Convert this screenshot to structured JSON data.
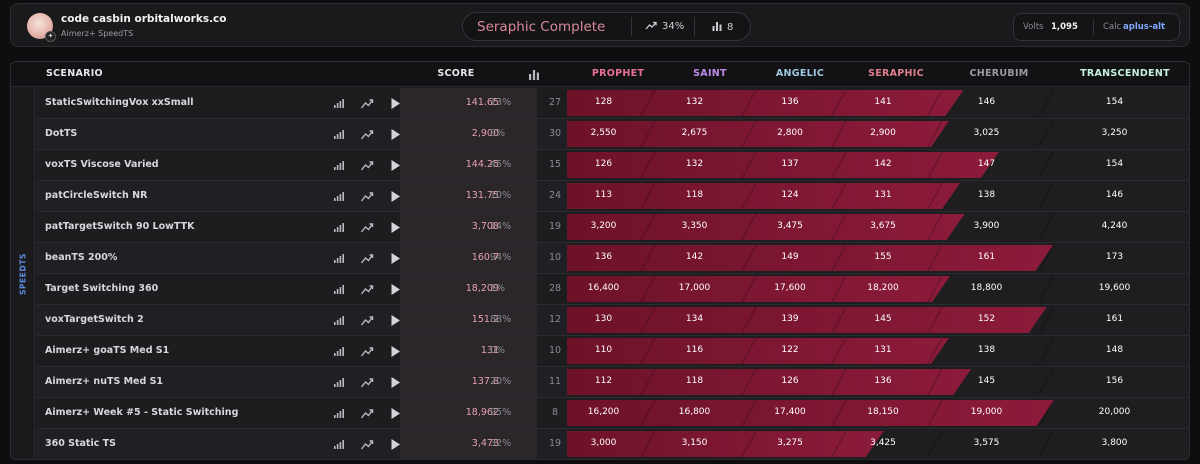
{
  "header": {
    "user": {
      "name": "code casbin orbitalworks.co",
      "subtitle": "Aimerz+ SpeedTS",
      "badge_glyph": "✦"
    },
    "rank": {
      "name": "Seraphic Complete",
      "progress": "34%",
      "count": "8"
    },
    "meta": {
      "volts_label": "Volts",
      "volts_value": "1,095",
      "calc_label": "Calc",
      "calc_value": "aplus-alt"
    }
  },
  "table": {
    "headers": {
      "scenario": "SCENARIO",
      "score": "SCORE",
      "plays_icon": "bar-chart-icon"
    },
    "tiers": [
      {
        "name": "PROPHET",
        "color": "#e86f9a"
      },
      {
        "name": "SAINT",
        "color": "#c08ae8"
      },
      {
        "name": "ANGELIC",
        "color": "#9ec8e0"
      },
      {
        "name": "SERAPHIC",
        "color": "#e07f8f"
      },
      {
        "name": "CHERUBIM",
        "color": "#9a9aa0"
      },
      {
        "name": "TRANSCENDENT",
        "color": "#c6f0e0"
      }
    ],
    "group_label": "SPEEDTS",
    "rows": [
      {
        "name": "StaticSwitchingVox xxSmall",
        "score": "141.65",
        "pct": "13%",
        "plays": "27",
        "progress": 0.13,
        "reached": 4,
        "thresholds": [
          "128",
          "132",
          "136",
          "141",
          "146",
          "154"
        ]
      },
      {
        "name": "DotTS",
        "score": "2,900",
        "pct": "0%",
        "plays": "30",
        "progress": 0.0,
        "reached": 4,
        "thresholds": [
          "2,550",
          "2,675",
          "2,800",
          "2,900",
          "3,025",
          "3,250"
        ]
      },
      {
        "name": "voxTS Viscose Varied",
        "score": "144.25",
        "pct": "45%",
        "plays": "15",
        "progress": 0.45,
        "reached": 4,
        "thresholds": [
          "126",
          "132",
          "137",
          "142",
          "147",
          "154"
        ]
      },
      {
        "name": "patCircleSwitch NR",
        "score": "131.75",
        "pct": "10%",
        "plays": "24",
        "progress": 0.1,
        "reached": 4,
        "thresholds": [
          "113",
          "118",
          "124",
          "131",
          "138",
          "146"
        ]
      },
      {
        "name": "patTargetSwitch 90 LowTTK",
        "score": "3,708",
        "pct": "14%",
        "plays": "19",
        "progress": 0.14,
        "reached": 4,
        "thresholds": [
          "3,200",
          "3,350",
          "3,475",
          "3,675",
          "3,900",
          "4,240"
        ]
      },
      {
        "name": "beanTS 200%",
        "score": "160.7",
        "pct": "94%",
        "plays": "10",
        "progress": 0.94,
        "reached": 4,
        "thresholds": [
          "136",
          "142",
          "149",
          "155",
          "161",
          "173"
        ]
      },
      {
        "name": "Target Switching 360",
        "score": "18,209",
        "pct": "1%",
        "plays": "28",
        "progress": 0.01,
        "reached": 4,
        "thresholds": [
          "16,400",
          "17,000",
          "17,600",
          "18,200",
          "18,800",
          "19,600"
        ]
      },
      {
        "name": "voxTargetSwitch 2",
        "score": "151.2",
        "pct": "88%",
        "plays": "12",
        "progress": 0.88,
        "reached": 4,
        "thresholds": [
          "130",
          "134",
          "139",
          "145",
          "152",
          "161"
        ]
      },
      {
        "name": "Aimerz+ goaTS Med S1",
        "score": "131",
        "pct": "0%",
        "plays": "10",
        "progress": 0.0,
        "reached": 4,
        "thresholds": [
          "110",
          "116",
          "122",
          "131",
          "138",
          "148"
        ]
      },
      {
        "name": "Aimerz+ nuTS Med S1",
        "score": "137.8",
        "pct": "20%",
        "plays": "11",
        "progress": 0.2,
        "reached": 4,
        "thresholds": [
          "112",
          "118",
          "126",
          "136",
          "145",
          "156"
        ]
      },
      {
        "name": "Aimerz+ Week #5 - Static Switching",
        "score": "18,962",
        "pct": "95%",
        "plays": "8",
        "progress": 0.95,
        "reached": 4,
        "thresholds": [
          "16,200",
          "16,800",
          "17,400",
          "18,150",
          "19,000",
          "20,000"
        ]
      },
      {
        "name": "360 Static TS",
        "score": "3,473",
        "pct": "32%",
        "plays": "19",
        "progress": 0.32,
        "reached": 3,
        "thresholds": [
          "3,000",
          "3,150",
          "3,275",
          "3,425",
          "3,575",
          "3,800"
        ]
      }
    ],
    "row_icons": [
      "leaderboard-icon",
      "trend-icon",
      "play-icon"
    ]
  }
}
